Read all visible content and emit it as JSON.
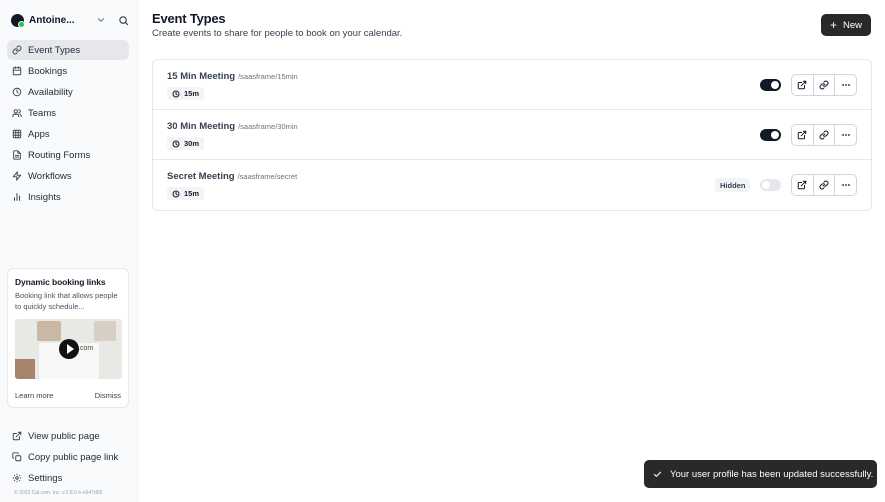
{
  "user": {
    "name": "Antoine..."
  },
  "sidebar": {
    "items": [
      {
        "label": "Event Types",
        "icon": "link-icon",
        "active": true
      },
      {
        "label": "Bookings",
        "icon": "calendar-icon"
      },
      {
        "label": "Availability",
        "icon": "clock-icon"
      },
      {
        "label": "Teams",
        "icon": "users-icon"
      },
      {
        "label": "Apps",
        "icon": "grid-icon"
      },
      {
        "label": "Routing Forms",
        "icon": "file-text-icon"
      },
      {
        "label": "Workflows",
        "icon": "zap-icon"
      },
      {
        "label": "Insights",
        "icon": "bar-chart-icon"
      }
    ],
    "promo": {
      "title": "Dynamic booking links",
      "description": "Booking link that allows people to quickly schedule...",
      "video_text": ".com",
      "learn_more": "Learn more",
      "dismiss": "Dismiss"
    },
    "bottom_items": [
      {
        "label": "View public page",
        "icon": "external-link-icon"
      },
      {
        "label": "Copy public page link",
        "icon": "copy-icon"
      },
      {
        "label": "Settings",
        "icon": "gear-icon"
      }
    ],
    "copyright": "© 2023 Cal.com, Inc. v.2.8.0-h-e647d55"
  },
  "main": {
    "title": "Event Types",
    "subtitle": "Create events to share for people to book on your calendar.",
    "new_button": "New",
    "events": [
      {
        "title": "15 Min Meeting",
        "slug": "/saasframe/15min",
        "duration": "15m",
        "enabled": true,
        "hidden_label": ""
      },
      {
        "title": "30 Min Meeting",
        "slug": "/saasframe/30min",
        "duration": "30m",
        "enabled": true,
        "hidden_label": ""
      },
      {
        "title": "Secret Meeting",
        "slug": "/saasframe/secret",
        "duration": "15m",
        "enabled": false,
        "hidden_label": "Hidden"
      }
    ]
  },
  "toast": {
    "message": "Your user profile has been updated successfully."
  },
  "colors": {
    "primary": "#292929",
    "sidebar_bg": "#f9fafb",
    "active_item": "#e5e7eb",
    "border": "#e5e7eb",
    "status_dot": "#22c55e"
  }
}
